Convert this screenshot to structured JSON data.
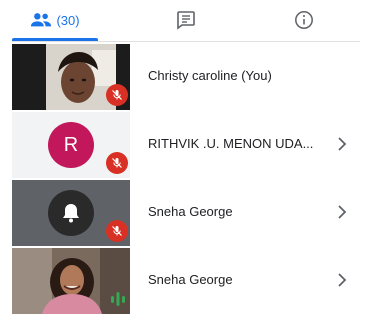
{
  "tabs": {
    "people_count": "(30)"
  },
  "participants": [
    {
      "name": "Christy caroline (You)",
      "muted": true
    },
    {
      "name": "RITHVIK .U. MENON UDA...",
      "initial": "R",
      "muted": true
    },
    {
      "name": "Sneha George",
      "muted": true
    },
    {
      "name": "Sneha George",
      "speaking": true
    }
  ],
  "colors": {
    "accent": "#1a73e8",
    "muted_badge": "#d93025",
    "avatar_r": "#c2185b",
    "speaking": "#34a853"
  }
}
